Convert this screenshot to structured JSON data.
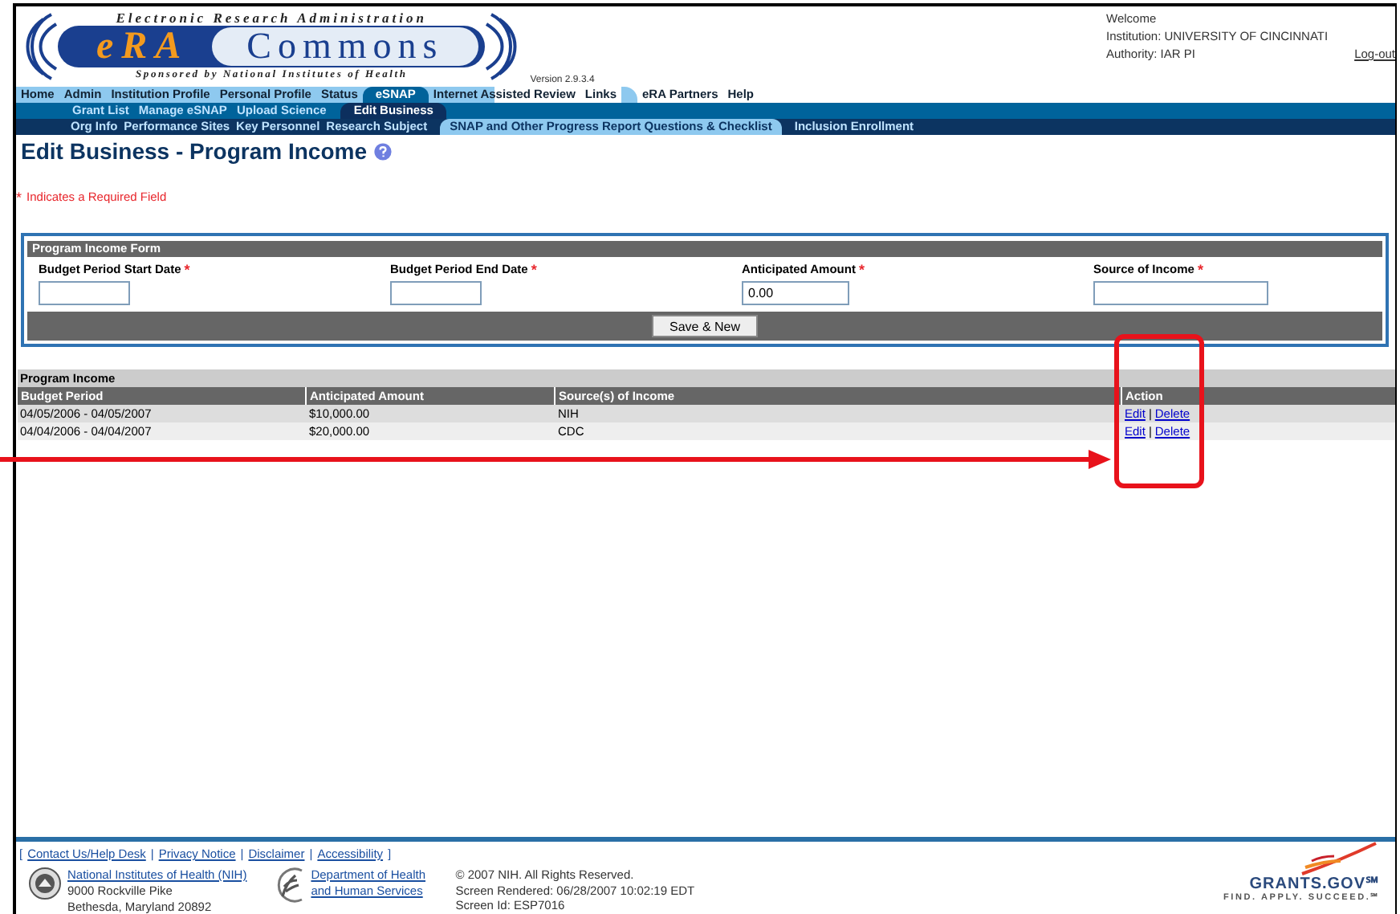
{
  "header": {
    "logo": {
      "top": "Electronic Research Administration",
      "brand_left": "eRA",
      "brand_right": "Commons",
      "bottom": "Sponsored by National Institutes of Health"
    },
    "version": "Version 2.9.3.4",
    "user": {
      "welcome": "Welcome",
      "institution": "Institution: UNIVERSITY OF CINCINNATI",
      "authority": "Authority:  IAR  PI",
      "logout": "Log-out"
    }
  },
  "nav": {
    "main": [
      {
        "label": "Home",
        "selected": false
      },
      {
        "label": "Admin",
        "selected": false
      },
      {
        "label": "Institution Profile",
        "selected": false
      },
      {
        "label": "Personal Profile",
        "selected": false
      },
      {
        "label": "Status",
        "selected": false
      },
      {
        "label": "eSNAP",
        "selected": true
      },
      {
        "label": "Internet Assisted Review",
        "selected": false
      },
      {
        "label": "Links",
        "selected": false
      },
      {
        "label": "eRA Partners",
        "selected": false
      },
      {
        "label": "Help",
        "selected": false
      }
    ],
    "sub": [
      {
        "label": "Grant List",
        "selected": false
      },
      {
        "label": "Manage eSNAP",
        "selected": false
      },
      {
        "label": "Upload Science",
        "selected": false
      },
      {
        "label": "Edit Business",
        "selected": true
      }
    ],
    "subsub": [
      {
        "label": "Org Info",
        "selected": false
      },
      {
        "label": "Performance Sites",
        "selected": false
      },
      {
        "label": "Key Personnel",
        "selected": false
      },
      {
        "label": "Research Subject",
        "selected": false
      },
      {
        "label": "SNAP and Other Progress Report Questions & Checklist",
        "selected": true
      },
      {
        "label": "Inclusion Enrollment",
        "selected": false
      }
    ]
  },
  "page_title": "Edit Business - Program Income",
  "required_note": {
    "mark": "*",
    "text": "Indicates a Required Field"
  },
  "form": {
    "title": "Program Income Form",
    "required_mark": "*",
    "fields": [
      {
        "label": "Budget Period Start Date",
        "required": true
      },
      {
        "label": "Budget Period End Date",
        "required": true
      },
      {
        "label": "Anticipated Amount",
        "required": true,
        "value": "0.00"
      },
      {
        "label": "Source of Income",
        "required": true
      }
    ],
    "button": "Save & New"
  },
  "table": {
    "title": "Program Income",
    "columns": [
      "Budget Period",
      "Anticipated Amount",
      "Source(s) of Income",
      "Action"
    ],
    "separator": "|",
    "rows": [
      {
        "cells": [
          "04/05/2006 - 04/05/2007",
          "$10,000.00",
          "NIH"
        ],
        "actions": [
          "Edit",
          "Delete"
        ]
      },
      {
        "cells": [
          "04/04/2006 - 04/04/2007",
          "$20,000.00",
          "CDC"
        ],
        "actions": [
          "Edit",
          "Delete"
        ]
      }
    ]
  },
  "footer": {
    "link_open": "[",
    "link_sep": "|",
    "link_close": "]",
    "links": [
      "Contact Us/Help Desk",
      "Privacy Notice",
      "Disclaimer",
      "Accessibility"
    ],
    "nih": {
      "link": "National Institutes of Health (NIH)",
      "address": [
        "9000 Rockville Pike",
        "Bethesda, Maryland 20892"
      ]
    },
    "hhs": {
      "link": "Department of Health and Human Services"
    },
    "info": [
      "© 2007 NIH. All Rights Reserved.",
      "Screen Rendered: 06/28/2007 10:02:19 EDT",
      "Screen Id: ESP7016"
    ],
    "grants": {
      "name": "GRANTS.GOV℠",
      "tagline": "FIND. APPLY. SUCCEED.℠"
    }
  }
}
